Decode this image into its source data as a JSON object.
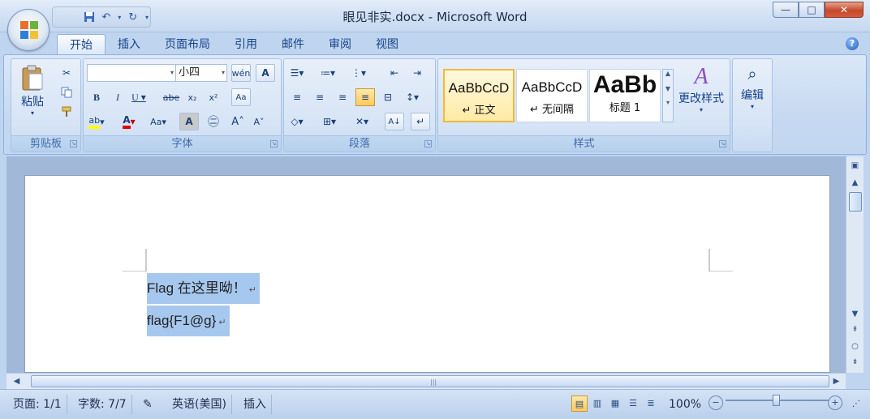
{
  "window": {
    "title": "眼见非实.docx - Microsoft Word",
    "min": "—",
    "max": "□",
    "close": "✕"
  },
  "ribbon_tabs": [
    "开始",
    "插入",
    "页面布局",
    "引用",
    "邮件",
    "审阅",
    "视图"
  ],
  "help": "?",
  "clipboard": {
    "paste_label": "粘贴",
    "group_label": "剪贴板"
  },
  "font": {
    "font_name": "",
    "font_size": "小四",
    "group_label": "字体"
  },
  "paragraph": {
    "group_label": "段落"
  },
  "styles": {
    "items": [
      {
        "sample": "AaBbCcD",
        "name": "↵ 正文"
      },
      {
        "sample": "AaBbCcD",
        "name": "↵ 无间隔"
      },
      {
        "sample": "AaBb",
        "name": "标题 1"
      }
    ],
    "change_styles": "更改样式",
    "group_label": "样式"
  },
  "editing": {
    "label": "编辑"
  },
  "document": {
    "lines": [
      "Flag 在这里呦！",
      "flag{F1@g}"
    ]
  },
  "status": {
    "page": "页面: 1/1",
    "words": "字数: 7/7",
    "language": "英语(美国)",
    "mode": "插入",
    "zoom": "100%",
    "zoom_level_percent": 100
  }
}
